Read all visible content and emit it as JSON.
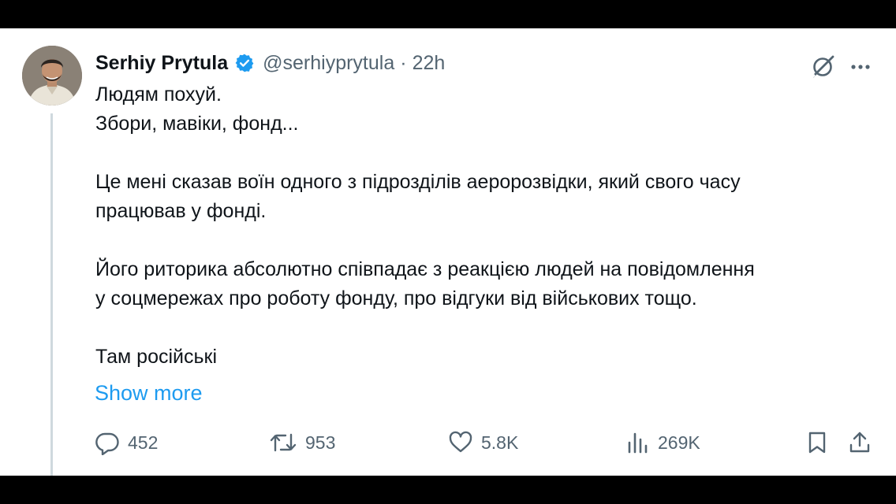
{
  "tweet": {
    "author": {
      "display_name": "Serhiy Prytula",
      "verified": true,
      "handle": "@serhiyprytula",
      "separator": "·",
      "time": "22h"
    },
    "body_lines": [
      "Людям похуй.",
      "Збори, мавіки, фонд...",
      "",
      "Це мені сказав воїн одного з підрозділів аеророзвідки, який свого часу",
      "працював у фонді.",
      "",
      "Його риторика абсолютно співпадає з реакцією людей на повідомлення",
      "у соцмережах про роботу фонду, про відгуки від військових тощо.",
      "",
      "Там російські"
    ],
    "show_more_label": "Show more",
    "stats": {
      "replies": "452",
      "reposts": "953",
      "likes": "5.8K",
      "views": "269K"
    }
  },
  "icons": {
    "top_right": [
      "grok-icon",
      "more-icon"
    ],
    "actions": [
      "reply-icon",
      "repost-icon",
      "like-icon",
      "views-icon",
      "bookmark-icon",
      "share-icon"
    ]
  },
  "colors": {
    "text": "#0f1419",
    "secondary": "#536471",
    "link": "#1d9bf0",
    "verified": "#1d9bf0"
  }
}
